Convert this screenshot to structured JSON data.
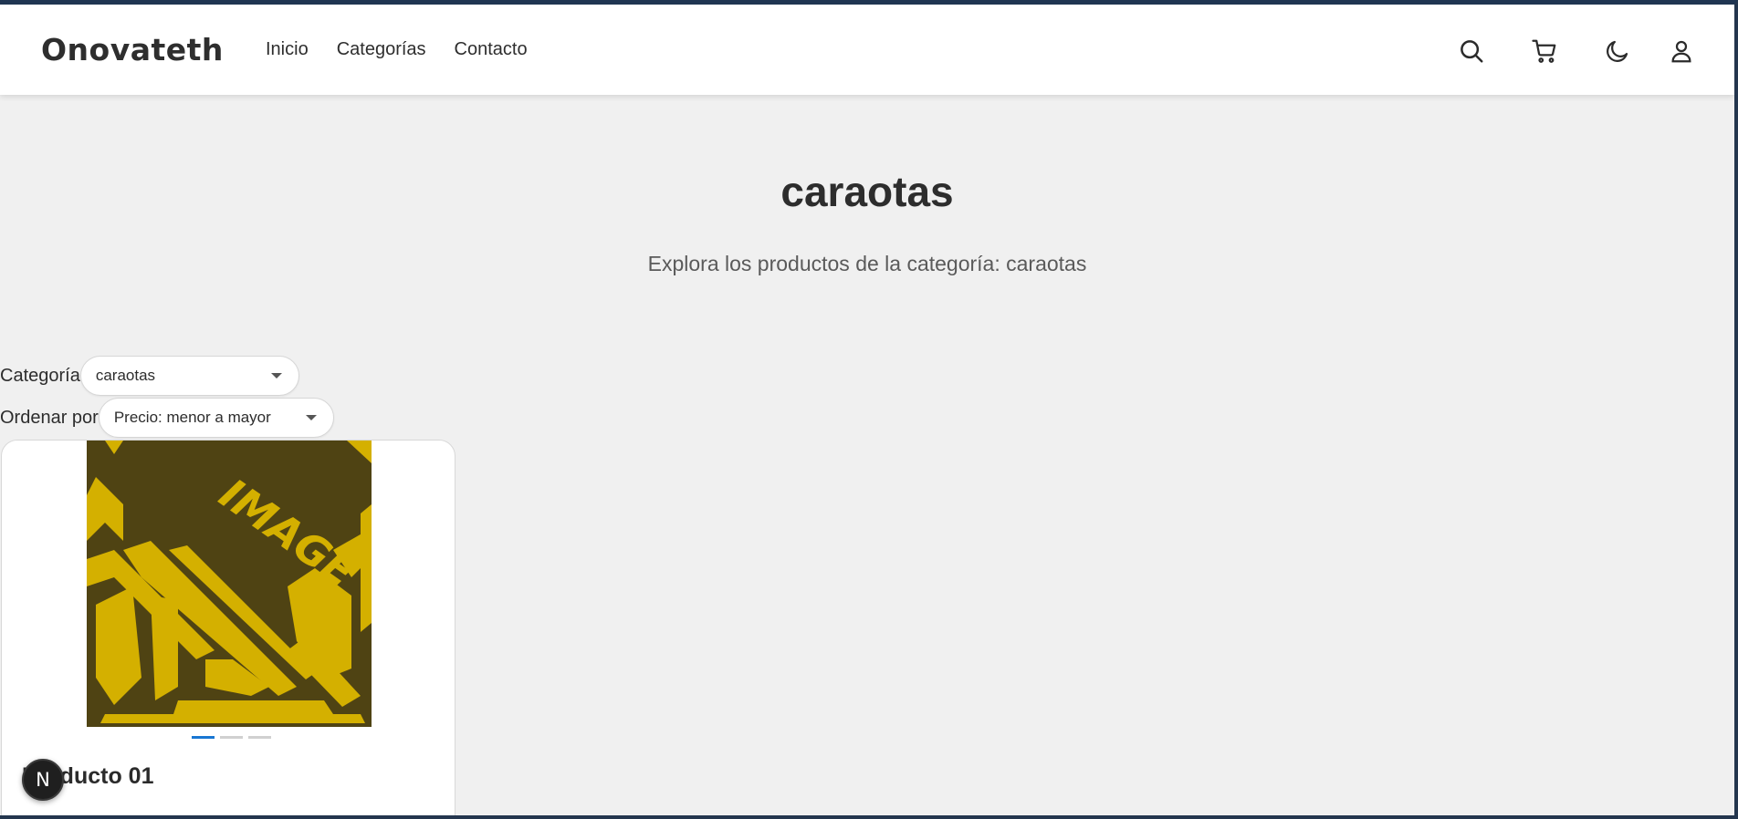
{
  "header": {
    "brand": "Onovateth",
    "nav": [
      "Inicio",
      "Categorías",
      "Contacto"
    ],
    "icons": [
      "search-icon",
      "cart-icon",
      "moon-icon",
      "user-icon"
    ]
  },
  "hero": {
    "title": "caraotas",
    "subtitle": "Explora los productos de la categoría: caraotas"
  },
  "filters": {
    "category_label": "Categoría",
    "category_value": "caraotas",
    "sort_label": "Ordenar por",
    "sort_value": "Precio: menor a mayor"
  },
  "products": [
    {
      "title": "Producto 01",
      "image_text": "IMAGE",
      "carousel_dots": 3,
      "active_dot": 0
    }
  ],
  "floating_badge": "N",
  "colors": {
    "accent": "#1976d2",
    "image_dark": "#4f4313",
    "image_gold": "#d4b000",
    "frame": "#1f3552"
  }
}
